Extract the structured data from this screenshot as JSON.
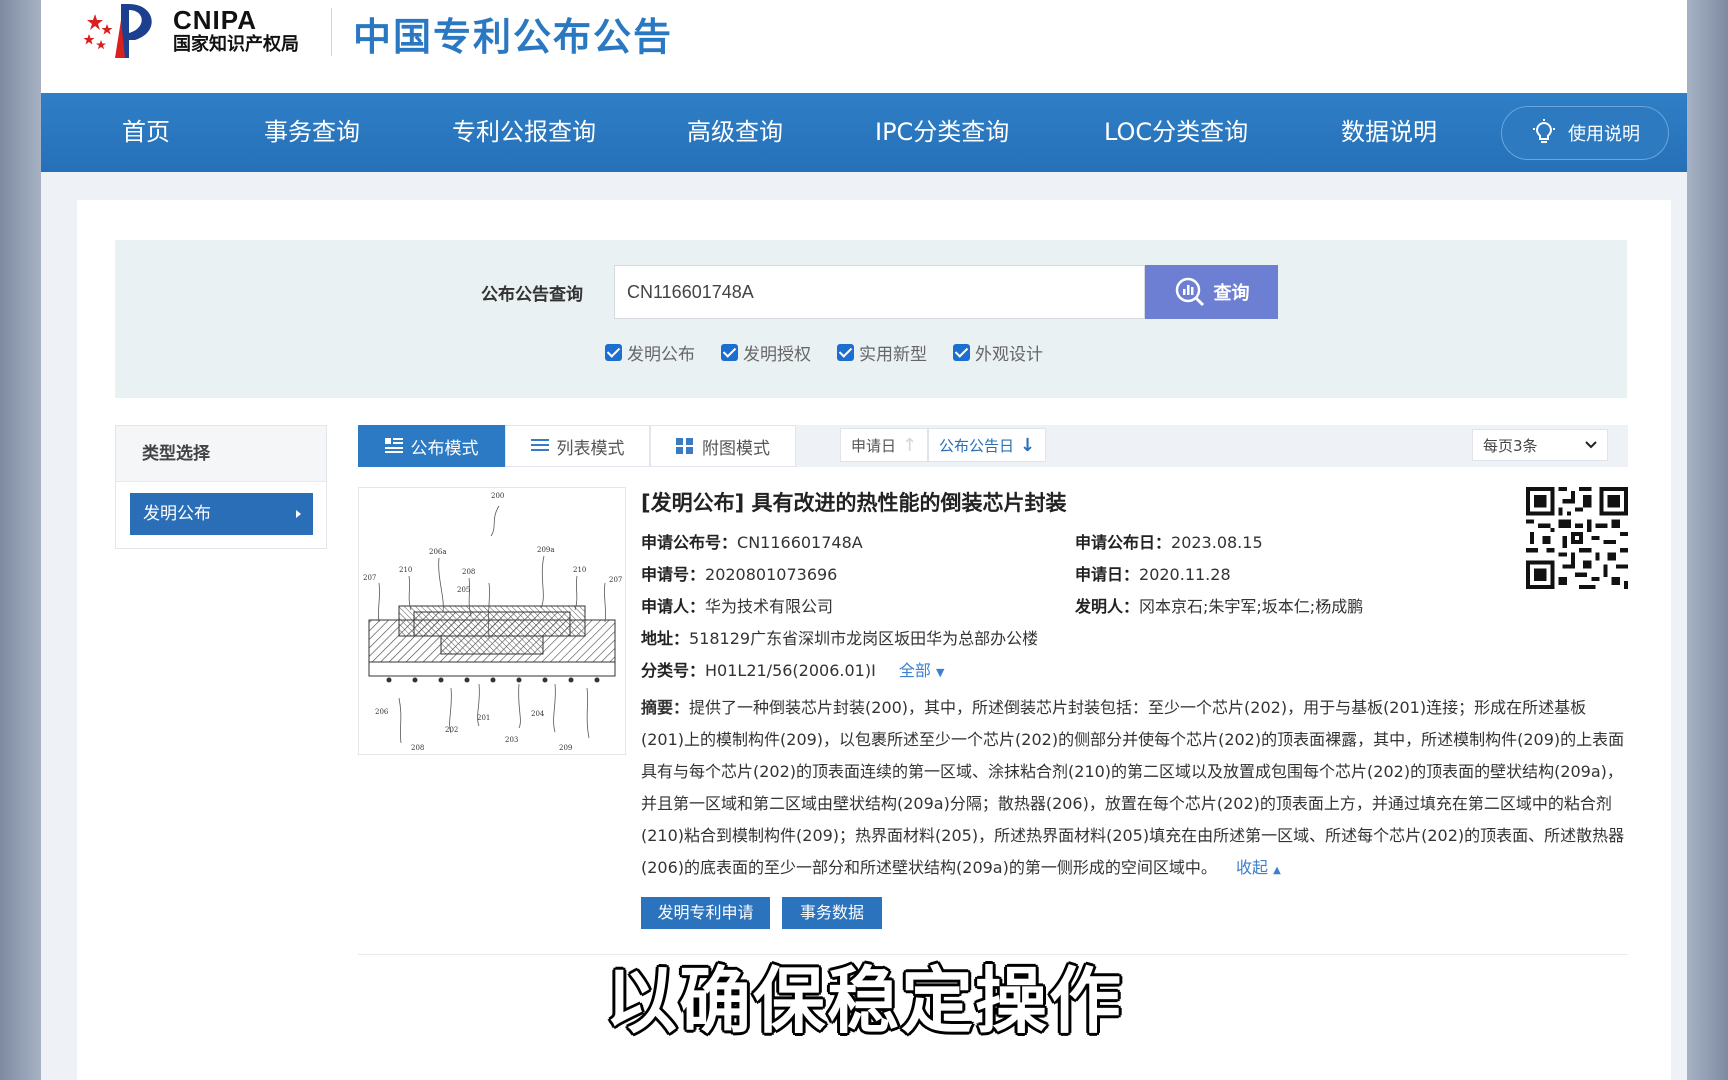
{
  "header": {
    "logo_en": "CNIPA",
    "logo_cn": "国家知识产权局",
    "site_title": "中国专利公布公告"
  },
  "nav": {
    "items": [
      "首页",
      "事务查询",
      "专利公报查询",
      "高级查询",
      "IPC分类查询",
      "LOC分类查询",
      "数据说明"
    ],
    "help": "使用说明"
  },
  "search": {
    "label": "公布公告查询",
    "value": "CN116601748A",
    "button": "查询",
    "checks": [
      "发明公布",
      "发明授权",
      "实用新型",
      "外观设计"
    ]
  },
  "type_select": {
    "title": "类型选择",
    "item": "发明公布"
  },
  "toolbar": {
    "modes": [
      "公布模式",
      "列表模式",
      "附图模式"
    ],
    "sort_apply": "申请日",
    "sort_pub": "公布公告日",
    "per_page": "每页3条"
  },
  "result": {
    "title": "[发明公布] 具有改进的热性能的倒装芯片封装",
    "pub_no_label": "申请公布号：",
    "pub_no": "CN116601748A",
    "pub_date_label": "申请公布日：",
    "pub_date": "2023.08.15",
    "app_no_label": "申请号：",
    "app_no": "2020801073696",
    "app_date_label": "申请日：",
    "app_date": "2020.11.28",
    "applicant_label": "申请人：",
    "applicant": "华为技术有限公司",
    "inventor_label": "发明人：",
    "inventor": "冈本京石;朱宇军;坂本仁;杨成鹏",
    "address_label": "地址：",
    "address": "518129广东省深圳市龙岗区坂田华为总部办公楼",
    "class_label": "分类号：",
    "class": "H01L21/56(2006.01)I",
    "class_more": "全部",
    "abstract_label": "摘要：",
    "abstract": "提供了一种倒装芯片封装(200)，其中，所述倒装芯片封装包括：至少一个芯片(202)，用于与基板(201)连接；形成在所述基板(201)上的模制构件(209)，以包裹所述至少一个芯片(202)的侧部分并使每个芯片(202)的顶表面裸露，其中，所述模制构件(209)的上表面具有与每个芯片(202)的顶表面连续的第一区域、涂抹粘合剂(210)的第二区域以及放置成包围每个芯片(202)的顶表面的壁状结构(209a)，并且第一区域和第二区域由壁状结构(209a)分隔；散热器(206)，放置在每个芯片(202)的顶表面上方，并通过填充在第二区域中的粘合剂(210)粘合到模制构件(209)；热界面材料(205)，所述热界面材料(205)填充在由所述第一区域、所述每个芯片(202)的顶表面、所述散热器(206)的底表面的至少一部分和所述壁状结构(209a)的第一侧形成的空间区域中。",
    "collapse": "收起",
    "btn_apply": "发明专利申请",
    "btn_affairs": "事务数据"
  },
  "figure_labels": [
    "200",
    "206a",
    "209a",
    "210",
    "208",
    "210",
    "207",
    "207",
    "205",
    "206",
    "201",
    "204",
    "202",
    "203",
    "208",
    "209"
  ],
  "subtitle": "以确保稳定操作",
  "colors": {
    "nav_blue": "#2a78c2",
    "search_button": "#6d7fd3",
    "active_mode": "#2c7ac4",
    "checkbox": "#1c6fd0"
  }
}
